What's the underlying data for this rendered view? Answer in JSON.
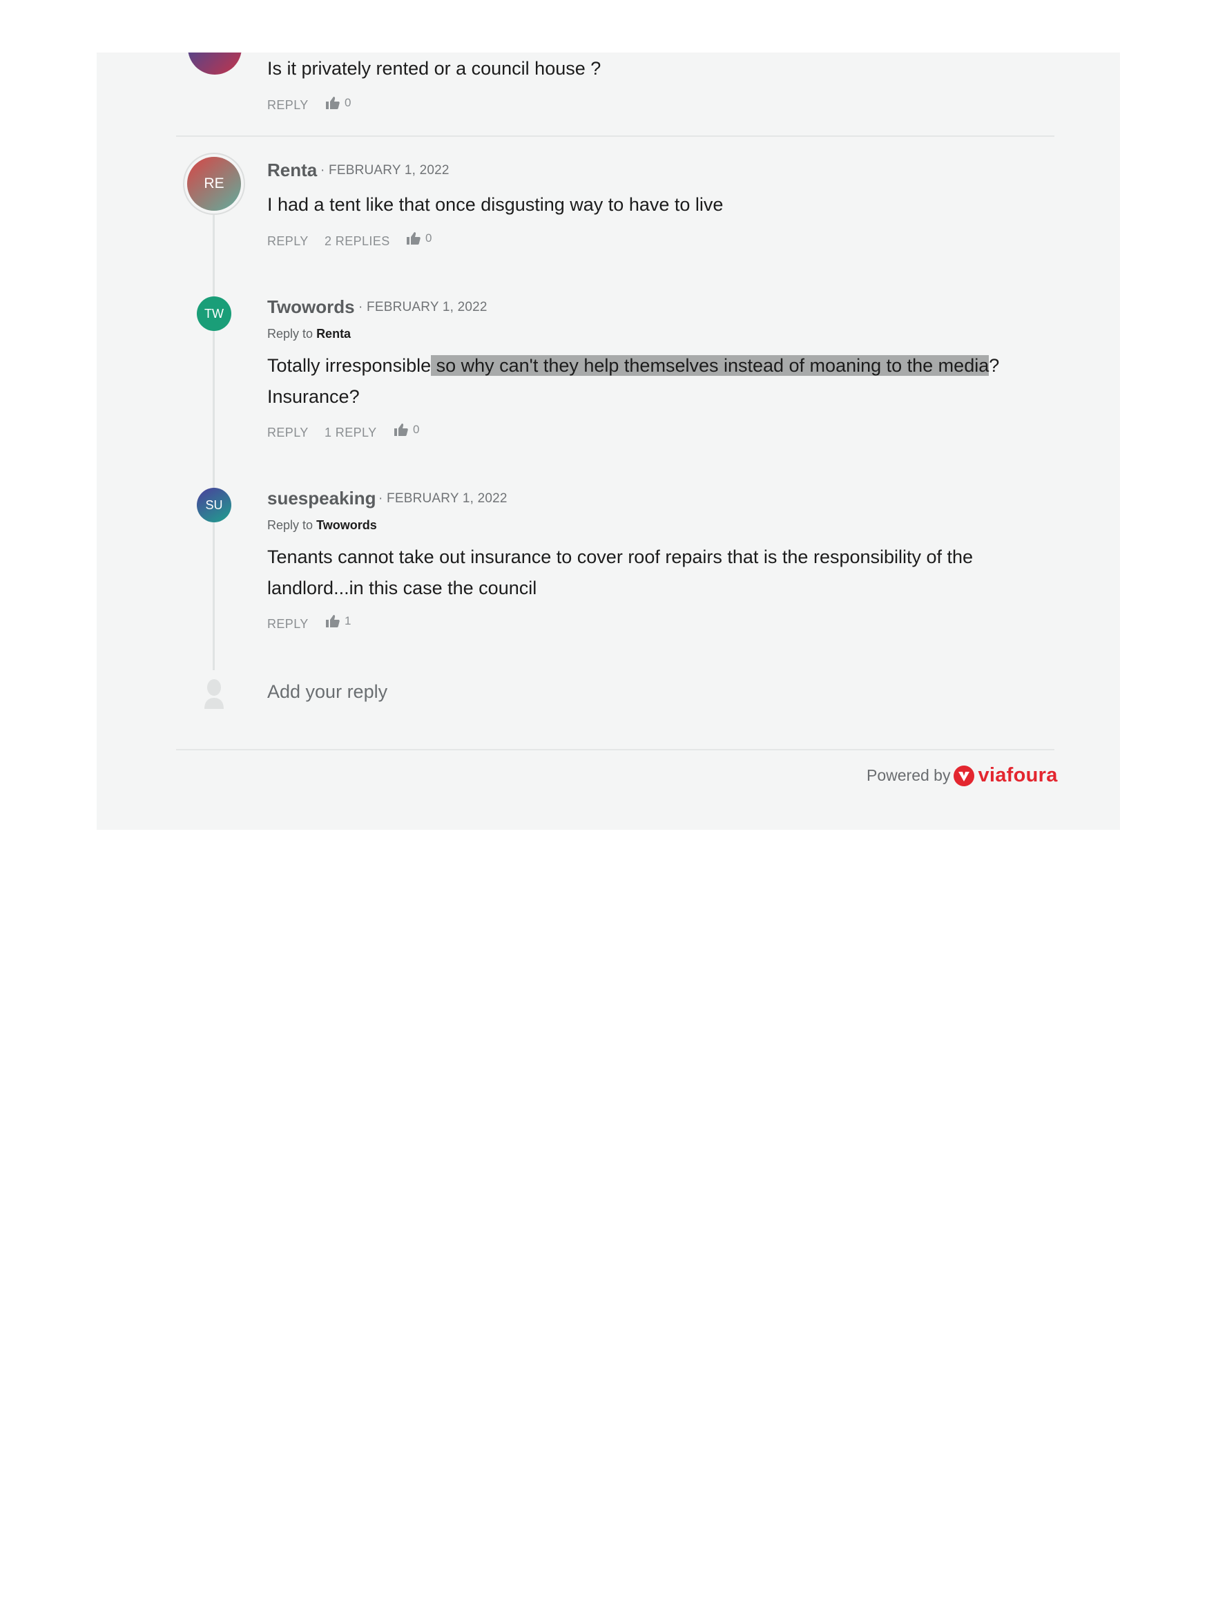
{
  "comments": [
    {
      "body": "Is it privately rented or a council house ?",
      "reply_label": "REPLY",
      "likes": "0"
    },
    {
      "initials": "RE",
      "author": "Renta",
      "date": "FEBRUARY 1, 2022",
      "body": "I had a tent like that once disgusting way to have to live",
      "reply_label": "REPLY",
      "replies_label": "2 REPLIES",
      "likes": "0"
    }
  ],
  "replies": [
    {
      "initials": "TW",
      "author": "Twowords",
      "date": "FEBRUARY 1, 2022",
      "reply_to_prefix": "Reply to",
      "reply_to": "Renta",
      "body_line1_a": "Totally irresponsible",
      "body_line1_highlight": " so why can't they help themselves instead of moaning to the media",
      "body_line1_b": "?",
      "body_line2": "Insurance?",
      "reply_label": "REPLY",
      "replies_label": "1 REPLY",
      "likes": "0"
    },
    {
      "initials": "SU",
      "author": "suespeaking",
      "date": "FEBRUARY 1, 2022",
      "reply_to_prefix": "Reply to",
      "reply_to": "Twowords",
      "body_line1": "Tenants cannot take out insurance to cover roof repairs that is the responsibility of the",
      "body_line2": "landlord...in this case the council",
      "reply_label": "REPLY",
      "likes": "1"
    }
  ],
  "reply_box": {
    "placeholder": "Add your reply"
  },
  "footer": {
    "powered_by": "Powered by",
    "brand": "viafoura"
  },
  "separator": "·",
  "icons": {
    "like": "thumbs-up-icon",
    "user": "user-placeholder-icon",
    "brand": "viafoura-logo-icon"
  },
  "colors": {
    "panel_bg": "#f4f5f5",
    "brand": "#e3262f",
    "avatar_re": "#d94d4d",
    "avatar_tw": "#1a9e78",
    "avatar_su": "#3b5d9c"
  }
}
